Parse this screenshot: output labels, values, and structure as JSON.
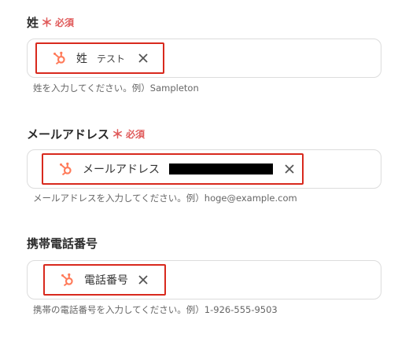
{
  "fields": [
    {
      "label": "姓",
      "required_mark": "＊",
      "required_text": "必須",
      "token_label": "姓",
      "token_sub": "テスト",
      "help": "姓を入力してください。例）Sampleton"
    },
    {
      "label": "メールアドレス",
      "required_mark": "＊",
      "required_text": "必須",
      "token_label": "メールアドレス",
      "help": "メールアドレスを入力してください。例）hoge@example.com"
    },
    {
      "label": "携帯電話番号",
      "token_label": "電話番号",
      "help": "携帯の電話番号を入力してください。例）1-926-555-9503"
    }
  ],
  "colors": {
    "required": "#e05a5a",
    "token_border": "#d8291d",
    "hubspot_orange": "#ff7a59"
  },
  "icons": {
    "token_icon": "hubspot-icon",
    "remove_icon": "close-icon"
  }
}
